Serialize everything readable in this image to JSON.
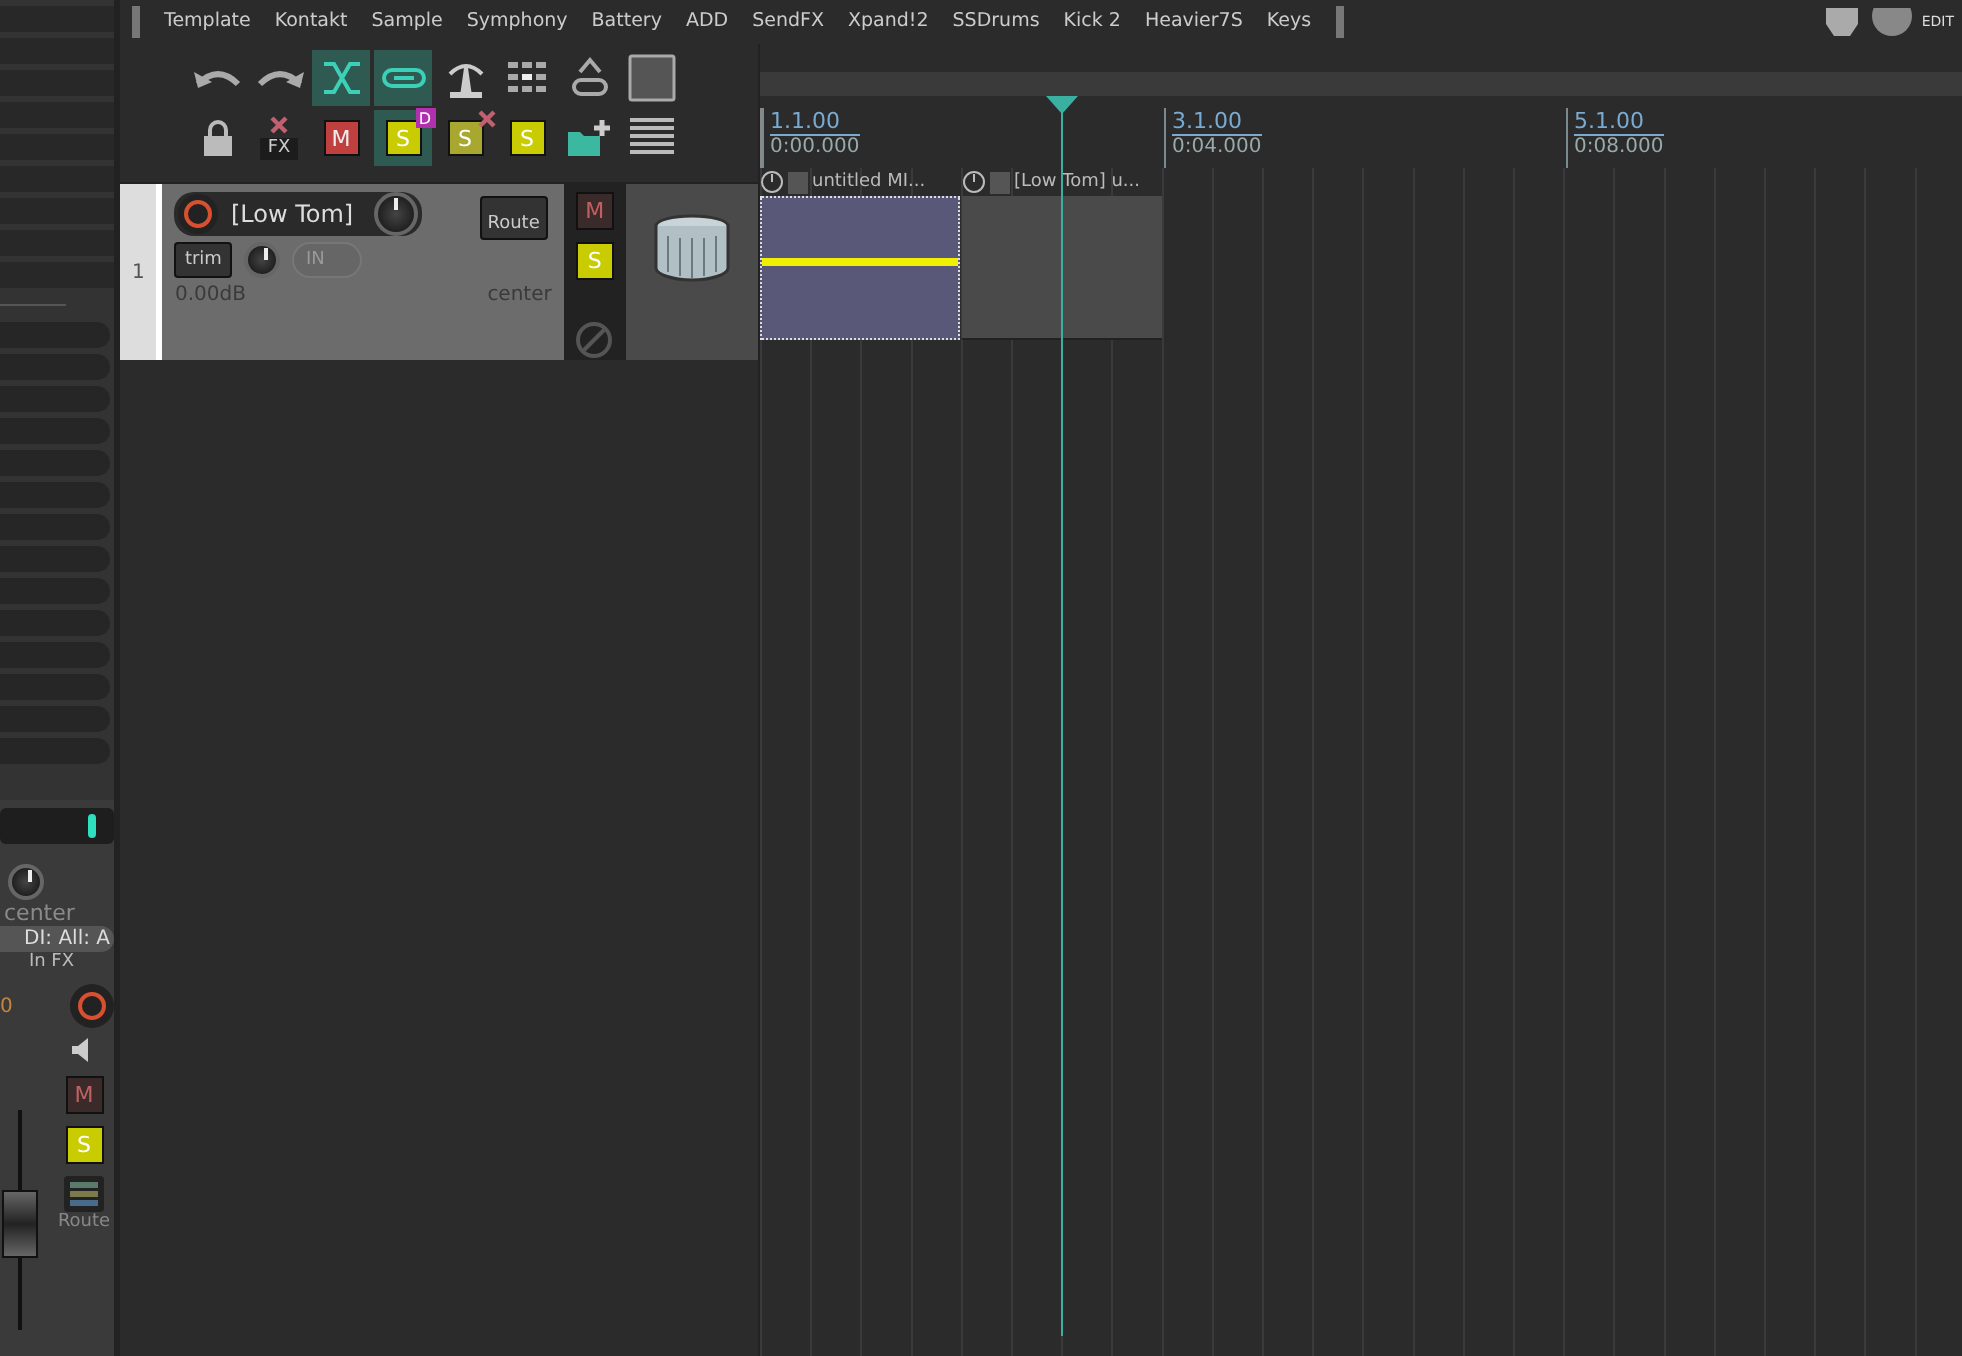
{
  "top_bar": {
    "items": [
      "Template",
      "Kontakt",
      "Sample",
      "Symphony",
      "Battery",
      "ADD",
      "SendFX",
      "Xpand!2",
      "SSDrums",
      "Kick 2",
      "Heavier7S",
      "Keys"
    ],
    "edit_label": "EDIT"
  },
  "toolbar": {
    "row_1": [
      {
        "kind": "undo",
        "active": false
      },
      {
        "kind": "redo",
        "active": false
      },
      {
        "kind": "crossfade",
        "active": true
      },
      {
        "kind": "link",
        "active": true
      },
      {
        "kind": "metronome",
        "active": false
      },
      {
        "kind": "grid",
        "active": false
      },
      {
        "kind": "unlink",
        "active": false
      },
      {
        "kind": "square",
        "active": false
      }
    ],
    "row_2": [
      {
        "kind": "lock",
        "active": false
      },
      {
        "kind": "fx",
        "label": "FX",
        "active": false
      },
      {
        "kind": "mute",
        "label": "M",
        "active": false
      },
      {
        "kind": "solo",
        "label": "S",
        "badge": "D",
        "active": true
      },
      {
        "kind": "solo-x",
        "label": "S",
        "active": false
      },
      {
        "kind": "solo",
        "label": "S",
        "active": false
      },
      {
        "kind": "folder",
        "active": false
      },
      {
        "kind": "lines",
        "active": false
      }
    ]
  },
  "track": {
    "number": "1",
    "name": "[Low Tom]",
    "route": "Route",
    "trim": "trim",
    "input": "IN",
    "volume": "0.00dB",
    "pan": "center",
    "mute": {
      "label": "M",
      "on": false
    },
    "solo": {
      "label": "S",
      "on": true
    }
  },
  "ruler": {
    "markers": [
      {
        "bar": "1.1.00",
        "time": "0:00.000"
      },
      {
        "bar": "3.1.00",
        "time": "0:04.000"
      },
      {
        "bar": "5.1.00",
        "time": "0:08.000"
      }
    ]
  },
  "items": [
    {
      "name": "untitled MI...",
      "kind": "midi",
      "selected": true
    },
    {
      "name": "[Low Tom] u...",
      "kind": "empty",
      "selected": false
    }
  ],
  "mixer_strip": {
    "pan": "center",
    "input": "DI: All: A",
    "fx": "In FX",
    "volume": "0",
    "mute": {
      "label": "M",
      "on": false
    },
    "solo": {
      "label": "S",
      "on": true
    },
    "route": "Route"
  }
}
